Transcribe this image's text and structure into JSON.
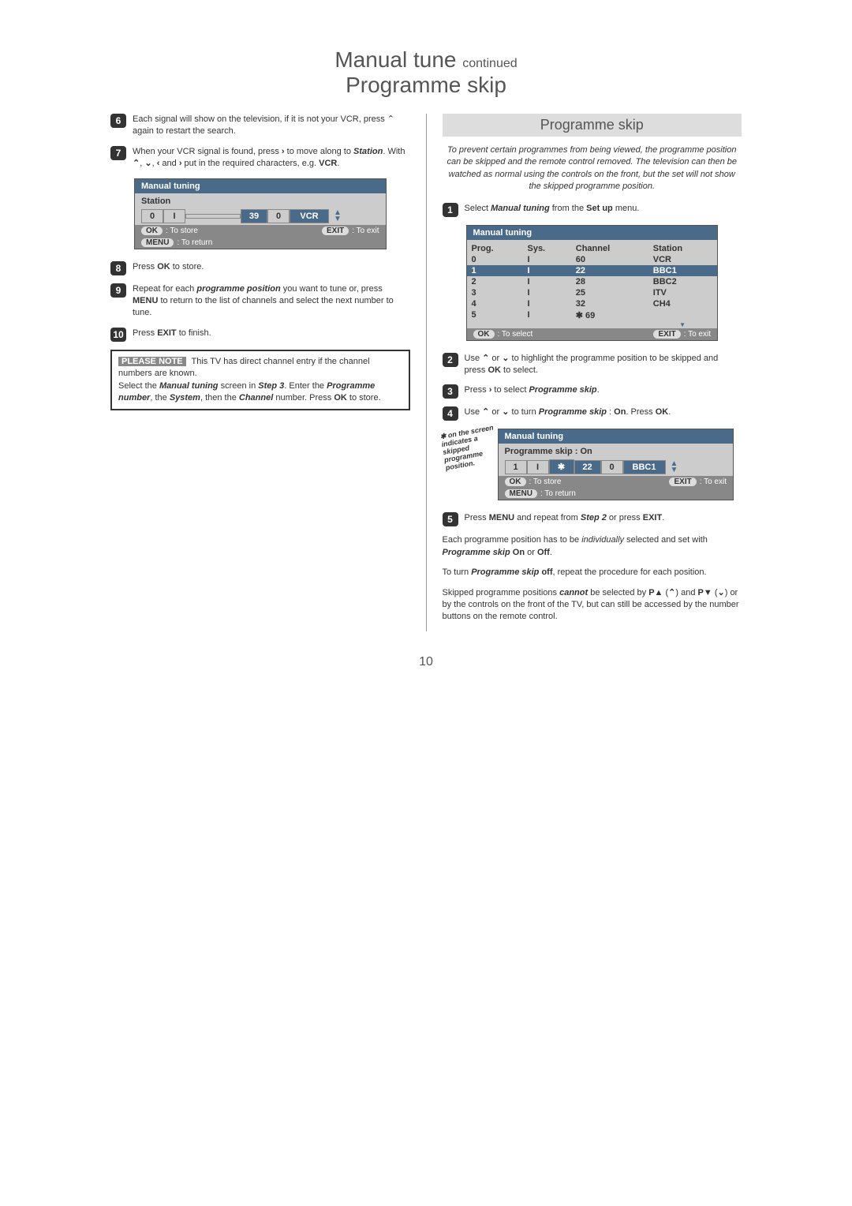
{
  "title": {
    "line1_main": "Manual tune",
    "line1_sub": "continued",
    "line2": "Programme skip"
  },
  "left": {
    "step6": "Each signal will show on the television, if it is not your VCR, press ⌃ again to restart the search.",
    "step7": "When your VCR signal is found, press › to move along to Station. With ⌃, ⌄, ‹ and › put in the required characters, e.g. VCR.",
    "osd1": {
      "title": "Manual tuning",
      "label": "Station",
      "cells": [
        "0",
        "I",
        "39",
        "0",
        "VCR"
      ],
      "footer": {
        "ok": "OK",
        "ok_text": ": To store",
        "exit": "EXIT",
        "exit_text": ": To exit",
        "menu": "MENU",
        "menu_text": ": To return"
      }
    },
    "step8": "Press OK to store.",
    "step9": "Repeat for each programme position you want to tune or, press MENU to return to the list of channels and select the next number to tune.",
    "step10": "Press EXIT to finish.",
    "note": {
      "badge": "PLEASE NOTE",
      "line1": "This TV has direct channel entry if the channel numbers are known.",
      "line2": "Select the Manual tuning screen in Step 3. Enter the Programme number, the System, then the Channel number. Press OK to store."
    }
  },
  "right": {
    "section_title": "Programme skip",
    "intro": "To prevent certain programmes from being viewed, the programme position can be skipped and the remote control removed. The television can then be watched as normal using the controls on the front, but the set will not show the skipped programme position.",
    "step1": "Select Manual tuning from the Set up menu.",
    "osd1": {
      "title": "Manual tuning",
      "headers": [
        "Prog.",
        "Sys.",
        "Channel",
        "Station"
      ],
      "rows": [
        {
          "prog": "0",
          "sys": "I",
          "channel": "60",
          "station": "VCR",
          "hl": false
        },
        {
          "prog": "1",
          "sys": "I",
          "channel": "22",
          "station": "BBC1",
          "hl": true
        },
        {
          "prog": "2",
          "sys": "I",
          "channel": "28",
          "station": "BBC2",
          "hl": false
        },
        {
          "prog": "3",
          "sys": "I",
          "channel": "25",
          "station": "ITV",
          "hl": false
        },
        {
          "prog": "4",
          "sys": "I",
          "channel": "32",
          "station": "CH4",
          "hl": false
        },
        {
          "prog": "5",
          "sys": "I",
          "channel": "✱  69",
          "station": "",
          "hl": false
        }
      ],
      "footer": {
        "ok": "OK",
        "ok_text": ": To select",
        "exit": "EXIT",
        "exit_text": ": To exit"
      }
    },
    "step2": "Use ⌃ or ⌄ to highlight the programme position to be skipped and press OK to select.",
    "step3": "Press › to select Programme skip.",
    "step4": "Use ⌃ or ⌄ to turn Programme skip : On. Press OK.",
    "skip_label": "✱ on the screen indicates a skipped programme position.",
    "osd2": {
      "title": "Manual tuning",
      "subtitle": "Programme skip : On",
      "cells": [
        "1",
        "I",
        "✱",
        "22",
        "0",
        "BBC1"
      ],
      "footer": {
        "ok": "OK",
        "ok_text": ": To store",
        "exit": "EXIT",
        "exit_text": ": To exit",
        "menu": "MENU",
        "menu_text": ": To return"
      }
    },
    "step5": "Press MENU and repeat from Step 2 or press EXIT.",
    "para1": "Each programme position has to be individually selected and set with Programme skip On or Off.",
    "para2": "To turn Programme skip off, repeat the procedure for each position.",
    "para3": "Skipped programme positions cannot be selected by P▲ (⌃) and P▼ (⌄) or by the controls on the front of the TV, but can still be accessed by the number buttons on the remote control."
  },
  "page_number": "10"
}
